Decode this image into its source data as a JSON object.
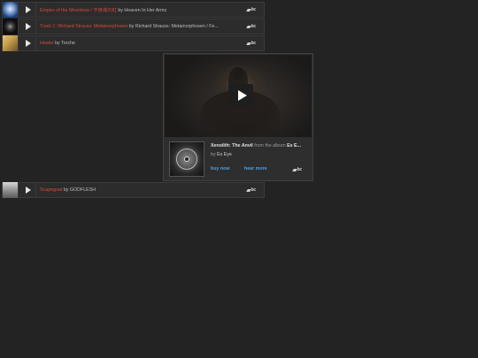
{
  "players": [
    {
      "title": "Empire of the Moonbow / 不夜城の虹",
      "by_word": "by",
      "artist": "Heaven In Her Arms",
      "thumb_colors": [
        "#1a3d7a",
        "#e8e8f0"
      ],
      "logo": "bc"
    },
    {
      "title": "Track 1: Richard Strauss: Metamorphosen",
      "by_word": "by",
      "artist": "Richard Strauss: Metamorphosen / Fe...",
      "thumb_colors": [
        "#0f0f0f",
        "#bfbfbf"
      ],
      "logo": "bc"
    },
    {
      "title": "Healer",
      "by_word": "by",
      "artist": "Torche",
      "thumb_colors": [
        "#c9a24a",
        "#6b4f2a"
      ],
      "logo": "bc"
    },
    {
      "title": "Scapegoat",
      "by_word": "by",
      "artist": "GODFLESH",
      "thumb_colors": [
        "#bdbdbd",
        "#5a5a5a"
      ],
      "logo": "bc"
    }
  ],
  "big_player": {
    "track": "Xenolith: The Anvil",
    "from_text": "from the album",
    "album": "Ex E...",
    "by_word": "by",
    "artist": "Ex Eye",
    "buy_label": "buy now",
    "hear_label": "hear more",
    "logo": "bc",
    "accent": "#4f9fde"
  },
  "colors": {
    "background": "#232323",
    "track_title": "#d8493a"
  }
}
